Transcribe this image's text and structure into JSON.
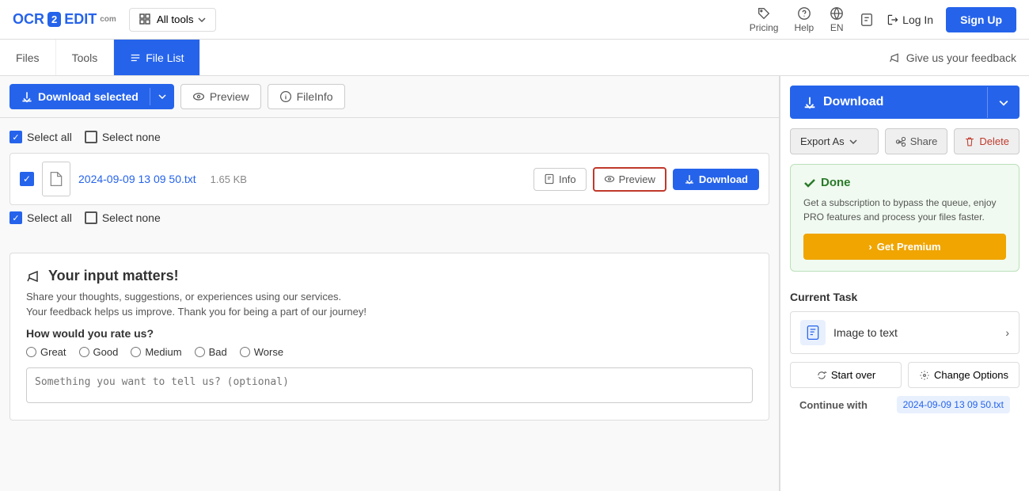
{
  "header": {
    "logo_ocr": "OCR",
    "logo_number": "2",
    "logo_edit": "EDIT",
    "logo_com": "com",
    "all_tools": "All tools",
    "pricing": "Pricing",
    "help": "Help",
    "lang": "EN",
    "login": "Log In",
    "signup": "Sign Up"
  },
  "subnav": {
    "files": "Files",
    "tools": "Tools",
    "file_list": "File List",
    "feedback_link": "Give us your feedback"
  },
  "toolbar": {
    "download_selected": "Download selected",
    "preview": "Preview",
    "fileinfo": "FileInfo"
  },
  "file_list": {
    "select_all": "Select all",
    "select_none": "Select none",
    "files": [
      {
        "name": "2024-09-09 13 09 50.txt",
        "size": "1.65 KB",
        "checked": true
      }
    ],
    "info_btn": "Info",
    "preview_btn": "Preview",
    "download_btn": "Download"
  },
  "feedback": {
    "title": "Your input matters!",
    "subtitle1": "Share your thoughts, suggestions, or experiences using our services.",
    "subtitle2": "Your feedback helps us improve. Thank you for being a part of our journey!",
    "question": "How would you rate us?",
    "ratings": [
      "Great",
      "Good",
      "Medium",
      "Bad",
      "Worse"
    ],
    "textarea_placeholder": "Something you want to tell us? (optional)"
  },
  "right_panel": {
    "download_btn": "Download",
    "export_as": "Export As",
    "share": "Share",
    "delete": "Delete",
    "done_title": "Done",
    "done_text": "Get a subscription to bypass the queue, enjoy PRO features and process your files faster.",
    "get_premium": "Get Premium",
    "current_task_title": "Current Task",
    "task_label": "Image to text",
    "start_over": "Start over",
    "change_options": "Change Options",
    "continue_with_label": "Continue with",
    "continue_with_file": "2024-09-09 13 09 50.txt"
  }
}
